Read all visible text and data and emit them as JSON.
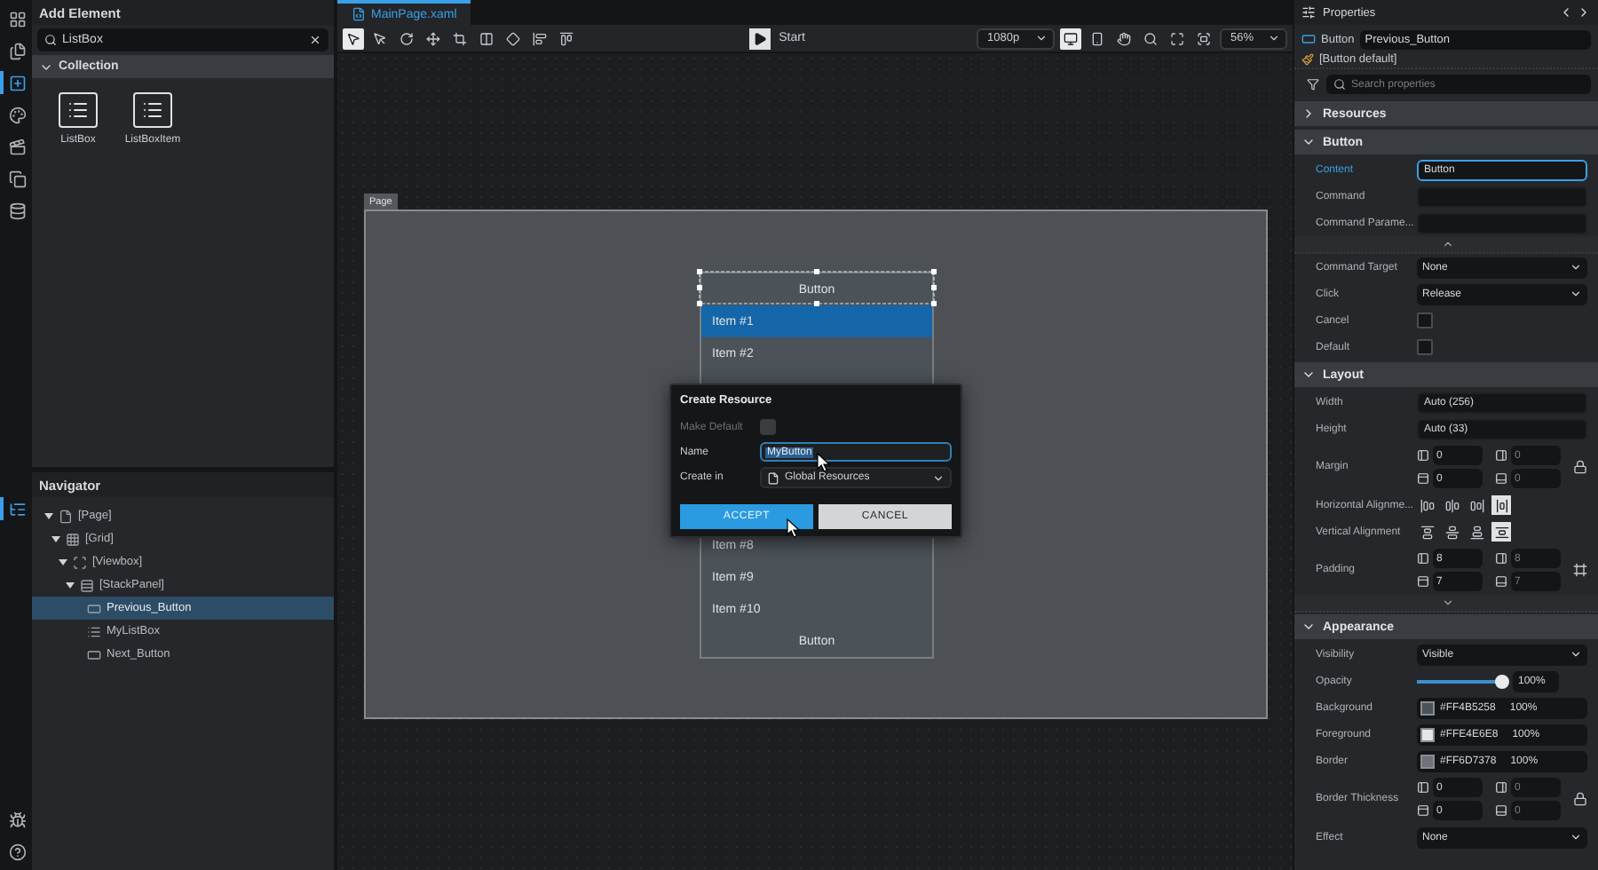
{
  "rail": {
    "top": [
      {
        "kind": "menu",
        "selected": false
      },
      {
        "kind": "pages",
        "selected": false
      },
      {
        "kind": "add",
        "selected": true
      },
      {
        "kind": "theme",
        "selected": false
      },
      {
        "kind": "media",
        "selected": false
      },
      {
        "kind": "copy",
        "selected": false
      },
      {
        "kind": "data",
        "selected": false
      }
    ],
    "bottom": [
      {
        "kind": "tree",
        "selected": true
      },
      {
        "kind": "bug",
        "selected": false
      },
      {
        "kind": "help",
        "selected": false
      }
    ]
  },
  "add_element": {
    "title": "Add Element",
    "search": {
      "value": "ListBox"
    },
    "group": {
      "label": "Collection",
      "expanded": true
    },
    "items": [
      {
        "label": "ListBox"
      },
      {
        "label": "ListBoxItem"
      }
    ]
  },
  "navigator": {
    "title": "Navigator",
    "tree": [
      {
        "label": "[Page]",
        "kind": "page",
        "expanded": true,
        "selected": false,
        "children": [
          {
            "label": "[Grid]",
            "kind": "grid",
            "expanded": true,
            "selected": false,
            "children": [
              {
                "label": "[Viewbox]",
                "kind": "viewbox",
                "expanded": true,
                "selected": false,
                "children": [
                  {
                    "label": "[StackPanel]",
                    "kind": "stack",
                    "expanded": true,
                    "selected": false,
                    "children": [
                      {
                        "label": "Previous_Button",
                        "kind": "button",
                        "selected": true
                      },
                      {
                        "label": "MyListBox",
                        "kind": "listbox",
                        "selected": false
                      },
                      {
                        "label": "Next_Button",
                        "kind": "button",
                        "selected": false
                      }
                    ]
                  }
                ]
              }
            ]
          }
        ]
      }
    ]
  },
  "document_tab": {
    "label": "MainPage.xaml",
    "selected": true
  },
  "toolbar": {
    "tools": [
      {
        "kind": "select",
        "selected": true
      },
      {
        "kind": "direct",
        "selected": false
      },
      {
        "kind": "rotate",
        "selected": false
      },
      {
        "kind": "move",
        "selected": false
      },
      {
        "kind": "crop",
        "selected": false
      },
      {
        "kind": "split",
        "selected": false
      },
      {
        "kind": "diamond",
        "selected": false
      },
      {
        "kind": "align-left",
        "selected": false
      },
      {
        "kind": "align-top",
        "selected": false
      }
    ],
    "run_label": "Start",
    "resolution": "1080p",
    "devices": [
      {
        "kind": "desktop",
        "selected": true
      },
      {
        "kind": "phone",
        "selected": false
      }
    ],
    "zoom": "56%"
  },
  "canvas": {
    "page_label": "Page",
    "listbox": {
      "top_button": "Button",
      "items_above": [
        {
          "label": "Item #1",
          "selected": true
        },
        {
          "label": "Item #2",
          "selected": false
        }
      ],
      "items_below": [
        {
          "label": "Item #8",
          "selected": false
        },
        {
          "label": "Item #9",
          "selected": false
        },
        {
          "label": "Item #10",
          "selected": false
        }
      ],
      "bottom_button": "Button"
    },
    "dialog": {
      "title": "Create Resource",
      "fields": [
        {
          "kind": "checkbox",
          "label": "Make Default",
          "disabled": true,
          "checked": false
        },
        {
          "kind": "text",
          "label": "Name",
          "value": "MyButton",
          "disabled": false
        },
        {
          "kind": "select",
          "label": "Create in",
          "value": "Global Resources"
        }
      ],
      "buttons": [
        {
          "kind": "primary",
          "label": "ACCEPT"
        },
        {
          "kind": "secondary",
          "label": "CANCEL"
        }
      ]
    }
  },
  "properties": {
    "title": "Properties",
    "type": "Button",
    "name": "Previous_Button",
    "style": "[Button default]",
    "search": {
      "placeholder": "Search properties"
    },
    "sections": [
      {
        "label": "Resources",
        "expanded": false
      },
      {
        "label": "Button",
        "expanded": true,
        "rows": [
          {
            "kind": "text",
            "label": "Content",
            "value": "Button",
            "active": true
          },
          {
            "kind": "text",
            "label": "Command",
            "active": false
          },
          {
            "kind": "text",
            "label": "Command Parame...",
            "active": false
          },
          {
            "kind": "toggle",
            "expanded": true
          },
          {
            "kind": "select",
            "label": "Command Target",
            "value": "None"
          },
          {
            "kind": "select",
            "label": "Click",
            "value": "Release"
          },
          {
            "kind": "checkbox",
            "label": "Cancel",
            "checked": false
          },
          {
            "kind": "checkbox",
            "label": "Default",
            "checked": false
          }
        ]
      },
      {
        "label": "Layout",
        "expanded": true,
        "rows": [
          {
            "kind": "text",
            "label": "Width",
            "value": "Auto (256)",
            "active": false
          },
          {
            "kind": "text",
            "label": "Height",
            "value": "Auto (33)",
            "active": false
          },
          {
            "kind": "thickness",
            "label": "Margin",
            "values": [
              "0",
              "0",
              "0",
              "0"
            ],
            "lock_icon": true
          },
          {
            "kind": "halign",
            "label": "Horizontal Alignme...",
            "options": [
              {
                "selected": false
              },
              {
                "selected": false
              },
              {
                "selected": false
              },
              {
                "selected": true
              }
            ]
          },
          {
            "kind": "valign",
            "label": "Vertical Alignment",
            "options": [
              {
                "selected": false
              },
              {
                "selected": false
              },
              {
                "selected": false
              },
              {
                "selected": true
              }
            ]
          },
          {
            "kind": "thickness",
            "label": "Padding",
            "values": [
              "8",
              "8",
              "7",
              "7"
            ],
            "frame_icon": true
          },
          {
            "kind": "toggle",
            "expanded": false
          }
        ]
      },
      {
        "label": "Appearance",
        "expanded": true,
        "rows": [
          {
            "kind": "select",
            "label": "Visibility",
            "value": "Visible"
          },
          {
            "kind": "slider",
            "label": "Opacity",
            "level": 1,
            "reading": "100%"
          },
          {
            "kind": "color",
            "label": "Background",
            "color": "#4b5258",
            "value": "#FF4B5258",
            "alpha": "100%"
          },
          {
            "kind": "color",
            "label": "Foreground",
            "color": "#e4e6e8",
            "value": "#FFE4E6E8",
            "alpha": "100%"
          },
          {
            "kind": "color",
            "label": "Border",
            "color": "#6d7378",
            "value": "#FF6D7378",
            "alpha": "100%"
          },
          {
            "kind": "thickness",
            "label": "Border Thickness",
            "values": [
              "0",
              "0",
              "0",
              "0"
            ],
            "lock_icon": true
          },
          {
            "kind": "select",
            "label": "Effect",
            "value": "None"
          }
        ]
      }
    ]
  }
}
